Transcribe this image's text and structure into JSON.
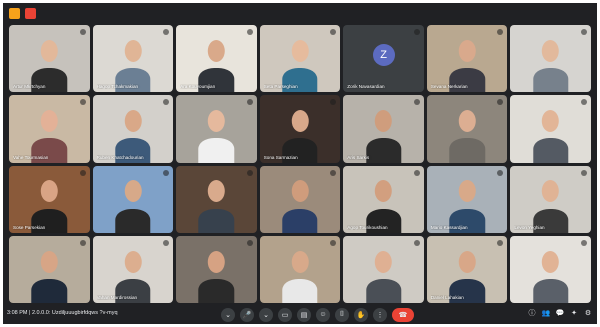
{
  "tiles": [
    {
      "name": "Artur Mkrtchyan",
      "bg": "#c6c2bc",
      "shirt": "#2c2c2c",
      "skin": "#e2b89a"
    },
    {
      "name": "Hagop Tchakmakian",
      "bg": "#dcd9d3",
      "shirt": "#6b7f94",
      "skin": "#e0b596"
    },
    {
      "name": "Ara Kouyoumjian",
      "bg": "#e8e4dc",
      "shirt": "#30343a",
      "skin": "#d9a98a"
    },
    {
      "name": "Seta Parseghian",
      "bg": "#cfc8be",
      "shirt": "#2f6f8f",
      "skin": "#e6bb9d"
    },
    {
      "name": "Zorik Navasardian",
      "avatar": "Z",
      "bg": "#3c4043"
    },
    {
      "name": "Sevana Nerkarian",
      "bg": "#b9a890",
      "shirt": "#3b3b44",
      "skin": "#d9a98c"
    },
    {
      "name": "",
      "bg": "#d6d4d0",
      "shirt": "#77818c",
      "skin": "#e2b99c"
    },
    {
      "name": "Vahe Tourmasian",
      "bg": "#c9b9a4",
      "shirt": "#7a4a4a",
      "skin": "#e3b197"
    },
    {
      "name": "Ruben Khatchadourian",
      "bg": "#d3d0cb",
      "shirt": "#3d5a7a",
      "skin": "#d9a888"
    },
    {
      "name": "",
      "bg": "#a7a39b",
      "shirt": "#f0f0f0",
      "skin": "#e5b99d"
    },
    {
      "name": "Sona Sarmazian",
      "bg": "#3b2f2a",
      "shirt": "#222222",
      "skin": "#d8a88a"
    },
    {
      "name": "Aris Sarkis",
      "bg": "#b7b2aa",
      "shirt": "#2b2b2b",
      "skin": "#cf9d7d"
    },
    {
      "name": "",
      "bg": "#8d867c",
      "shirt": "#6e6a64",
      "skin": "#dcae92"
    },
    {
      "name": "",
      "bg": "#e0ddd7",
      "shirt": "#545a63",
      "skin": "#e2b597"
    },
    {
      "name": "Sose Parsekian",
      "bg": "#8a5a3a",
      "shirt": "#1f1f1f",
      "skin": "#d9a485"
    },
    {
      "name": "",
      "bg": "#7fa1c8",
      "shirt": "#2a2a2a",
      "skin": "#d7a989"
    },
    {
      "name": "",
      "bg": "#5a4638",
      "shirt": "#37414d",
      "skin": "#d9aa8c"
    },
    {
      "name": "",
      "bg": "#9b8b7b",
      "shirt": "#2b3f67",
      "skin": "#cf9c7c"
    },
    {
      "name": "Agop Tourikoushian",
      "bg": "#c8c3ba",
      "shirt": "#232323",
      "skin": "#d29f7f"
    },
    {
      "name": "Mario Kassardjian",
      "bg": "#a9b1b8",
      "shirt": "#2d4a6a",
      "skin": "#d8a989"
    },
    {
      "name": "Levon Yeghian",
      "bg": "#cfccc6",
      "shirt": "#3a3a3a",
      "skin": "#e0b395"
    },
    {
      "name": "",
      "bg": "#b6ac9c",
      "shirt": "#1f2a3a",
      "skin": "#d7a586"
    },
    {
      "name": "Vahan Mardirossian",
      "bg": "#d8d4ce",
      "shirt": "#3b3f44",
      "skin": "#dcae8f"
    },
    {
      "name": "",
      "bg": "#7a7168",
      "shirt": "#2a2a2a",
      "skin": "#d6a283"
    },
    {
      "name": "",
      "bg": "#b3a28c",
      "shirt": "#e8e8e8",
      "skin": "#d8a98a"
    },
    {
      "name": "",
      "bg": "#cfcbc4",
      "shirt": "#4a4f56",
      "skin": "#dfb093"
    },
    {
      "name": "Daniel Lahakian",
      "bg": "#c8c0b2",
      "shirt": "#26344a",
      "skin": "#d8a788"
    },
    {
      "name": "",
      "bg": "#e4e1dc",
      "shirt": "#5a6069",
      "skin": "#e1b395"
    }
  ],
  "bottom": {
    "time": "3:08 PM",
    "meeting": "| 2.0.0.0: Uzdiljuuugbirfdqws ?v-myq",
    "controls": [
      "⌄",
      "🎤",
      "⌄",
      "▭",
      "▤",
      "☺",
      "⌷",
      "✋",
      "⋮",
      "☎"
    ],
    "right_icons": [
      "ⓘ",
      "👥",
      "💬",
      "✦",
      "⚙"
    ]
  }
}
